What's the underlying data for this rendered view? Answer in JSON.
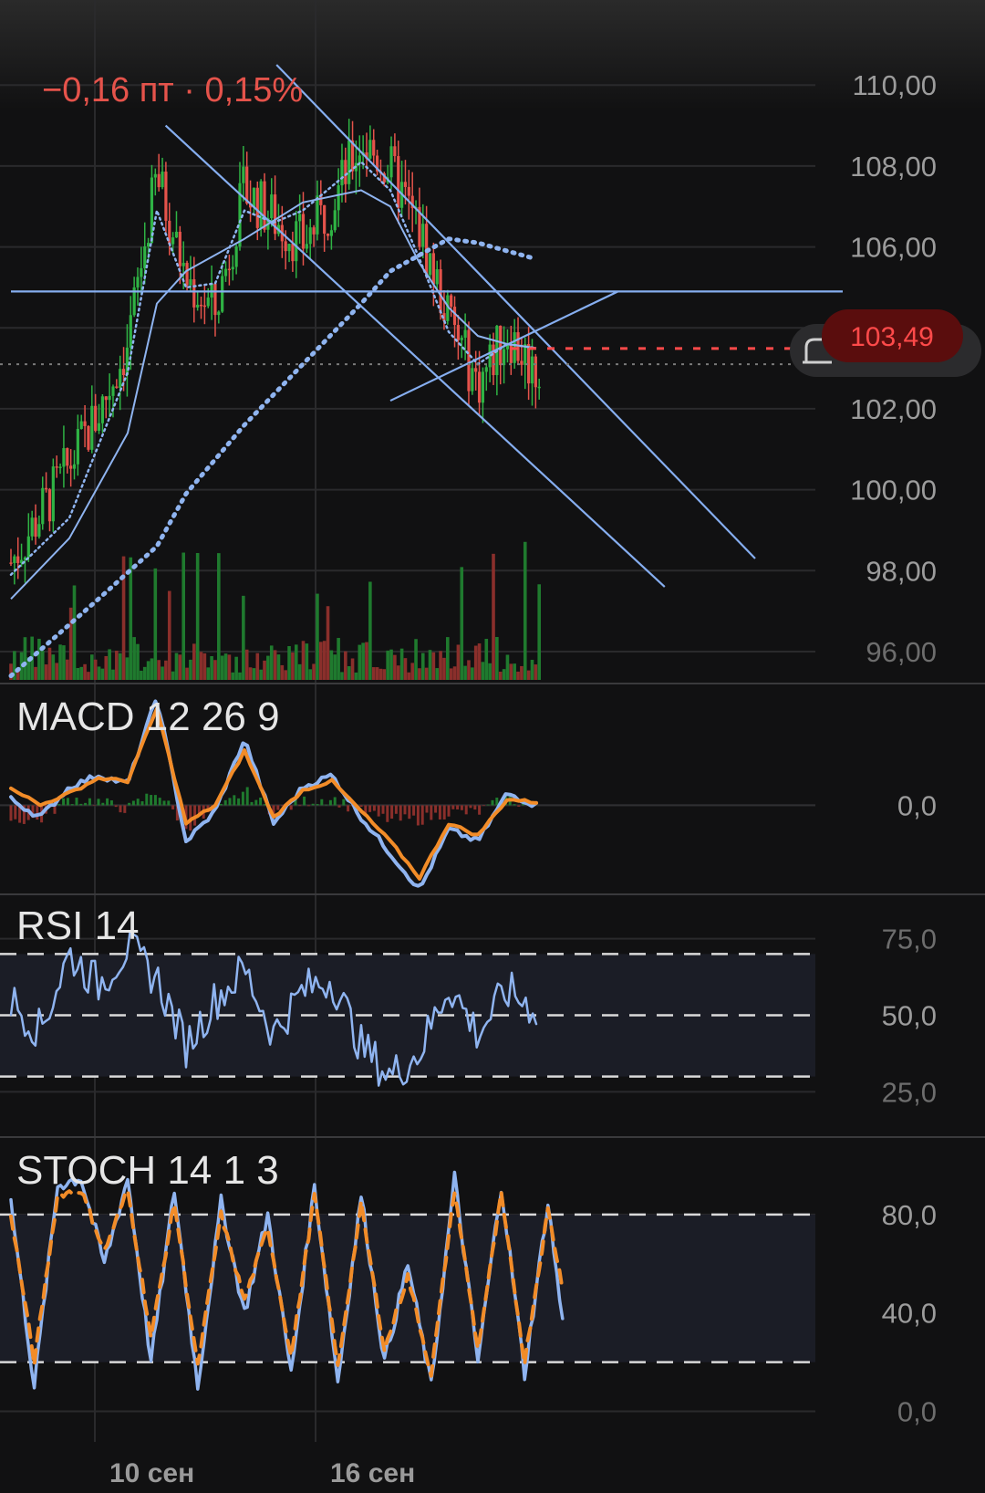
{
  "header": {
    "change_text": "−0,16 пт · 0,15%"
  },
  "colors": {
    "background": "#111112",
    "grid": "#2a2a2c",
    "up": "#2fb344",
    "down": "#e5534b",
    "ma": "#8fb4f0",
    "trendline": "#86aef0",
    "signal": "#f28c28",
    "price_badge": "#5a0d0d",
    "price_text": "#ff4a4a"
  },
  "dates": [
    {
      "label": "10 сен",
      "x": 10
    },
    {
      "label": "16 сен",
      "x": 16
    }
  ],
  "chart_data": [
    {
      "type": "candlestick",
      "title": "",
      "x": [
        0,
        1,
        2,
        3,
        4,
        5,
        6,
        7,
        8,
        9,
        10,
        11,
        12,
        13,
        14,
        15,
        16,
        17,
        18,
        19,
        20,
        21,
        22,
        23,
        24,
        25
      ],
      "close": [
        98.2,
        99.4,
        100.6,
        101.9,
        103.6,
        107.8,
        105.2,
        104.4,
        107.4,
        106.7,
        106.1,
        107.1,
        108.6,
        107.9,
        106.4,
        104.2,
        102.6,
        103.9,
        102.9,
        103.6,
        103.49
      ],
      "ylim": [
        95.3,
        111.2
      ],
      "yticks": [
        "110,00",
        "108,00",
        "106,00",
        "104,00",
        "102,00",
        "100,00",
        "98,00",
        "96,00"
      ],
      "ytick_values": [
        110,
        108,
        106,
        104,
        102,
        100,
        98,
        96
      ],
      "last_price": "103,49",
      "last_price_value": 103.49,
      "dotted_level": 103.1,
      "moving_averages": [
        {
          "style": "dotted-thick",
          "points": [
            [
              0,
              95.4
            ],
            [
              3,
              97.3
            ],
            [
              5,
              98.6
            ],
            [
              6,
              99.9
            ],
            [
              8,
              101.6
            ],
            [
              10,
              103.1
            ],
            [
              12,
              104.6
            ],
            [
              13,
              105.4
            ],
            [
              14,
              105.8
            ],
            [
              15,
              106.2
            ],
            [
              16,
              106.1
            ],
            [
              17,
              105.9
            ],
            [
              18,
              105.7
            ]
          ]
        },
        {
          "style": "solid",
          "points": [
            [
              0,
              97.3
            ],
            [
              2,
              98.8
            ],
            [
              4,
              101.4
            ],
            [
              5,
              104.6
            ],
            [
              6,
              105.4
            ],
            [
              8,
              106.2
            ],
            [
              10,
              107.1
            ],
            [
              12,
              107.4
            ],
            [
              13,
              107.0
            ],
            [
              14,
              105.6
            ],
            [
              15,
              104.5
            ],
            [
              16,
              103.8
            ],
            [
              17,
              103.6
            ],
            [
              18,
              103.5
            ]
          ]
        },
        {
          "style": "dotted-thin",
          "points": [
            [
              0,
              97.9
            ],
            [
              2,
              99.3
            ],
            [
              4,
              102.9
            ],
            [
              5,
              106.9
            ],
            [
              6,
              105.0
            ],
            [
              7,
              105.1
            ],
            [
              8,
              106.9
            ],
            [
              9,
              106.6
            ],
            [
              10,
              106.9
            ],
            [
              11,
              107.5
            ],
            [
              12,
              108.1
            ],
            [
              13,
              107.4
            ],
            [
              14,
              105.7
            ],
            [
              15,
              103.9
            ],
            [
              16,
              103.1
            ],
            [
              17,
              103.6
            ],
            [
              18,
              103.5
            ]
          ]
        }
      ],
      "trendlines": [
        {
          "from": [
            5.3,
            109.0
          ],
          "to": [
            22.4,
            97.6
          ]
        },
        {
          "from": [
            9.1,
            110.5
          ],
          "to": [
            25.5,
            98.3
          ]
        },
        {
          "from": [
            13.0,
            102.2
          ],
          "to": [
            20.8,
            104.9
          ]
        },
        {
          "from": [
            0.0,
            104.9
          ],
          "to": [
            28.5,
            104.9
          ]
        }
      ],
      "volume_note": "bars"
    },
    {
      "type": "line",
      "title": "MACD 12 26 9",
      "ylim": [
        -1.4,
        1.7
      ],
      "yticks": [
        "0,0"
      ],
      "ytick_values": [
        0
      ],
      "series": [
        {
          "role": "macd",
          "points": [
            [
              0,
              0.1
            ],
            [
              1,
              -0.2
            ],
            [
              2,
              0.3
            ],
            [
              3,
              0.5
            ],
            [
              4,
              0.35
            ],
            [
              5,
              1.8
            ],
            [
              6,
              -0.6
            ],
            [
              7,
              -0.1
            ],
            [
              8,
              1.1
            ],
            [
              9,
              -0.3
            ],
            [
              10,
              0.3
            ],
            [
              11,
              0.5
            ],
            [
              12,
              -0.2
            ],
            [
              13,
              -0.8
            ],
            [
              14,
              -1.4
            ],
            [
              15,
              -0.4
            ],
            [
              16,
              -0.6
            ],
            [
              17,
              0.2
            ],
            [
              18,
              0.0
            ]
          ]
        },
        {
          "role": "signal",
          "points": [
            [
              0,
              0.3
            ],
            [
              1,
              0.0
            ],
            [
              2,
              0.2
            ],
            [
              3,
              0.45
            ],
            [
              4,
              0.4
            ],
            [
              5,
              1.6
            ],
            [
              6,
              -0.3
            ],
            [
              7,
              0.0
            ],
            [
              8,
              0.9
            ],
            [
              9,
              -0.2
            ],
            [
              10,
              0.25
            ],
            [
              11,
              0.4
            ],
            [
              12,
              -0.1
            ],
            [
              13,
              -0.6
            ],
            [
              14,
              -1.2
            ],
            [
              15,
              -0.3
            ],
            [
              16,
              -0.5
            ],
            [
              17,
              0.1
            ],
            [
              18,
              0.05
            ]
          ]
        }
      ]
    },
    {
      "type": "line",
      "title": "RSI 14",
      "ylim": [
        15,
        85
      ],
      "yticks": [
        "75,0",
        "50,0",
        "25,0"
      ],
      "ytick_values": [
        75,
        50,
        25
      ],
      "bands": [
        70,
        50,
        30
      ],
      "series": [
        {
          "role": "rsi",
          "points": [
            [
              0,
              55
            ],
            [
              1,
              45
            ],
            [
              2,
              70
            ],
            [
              3,
              60
            ],
            [
              4,
              72
            ],
            [
              5,
              62
            ],
            [
              6,
              40
            ],
            [
              7,
              55
            ],
            [
              8,
              65
            ],
            [
              9,
              44
            ],
            [
              10,
              58
            ],
            [
              11,
              62
            ],
            [
              12,
              40
            ],
            [
              13,
              30
            ],
            [
              14,
              38
            ],
            [
              15,
              60
            ],
            [
              16,
              44
            ],
            [
              17,
              58
            ],
            [
              18,
              52
            ]
          ]
        }
      ]
    },
    {
      "type": "line",
      "title": "STOCH 14 1 3",
      "ylim": [
        -5,
        110
      ],
      "yticks": [
        "80,0",
        "40,0",
        "0,0"
      ],
      "ytick_values": [
        80,
        40,
        0
      ],
      "bands": [
        80,
        20
      ],
      "series": [
        {
          "role": "k",
          "points": [
            [
              0,
              85
            ],
            [
              0.8,
              10
            ],
            [
              1.6,
              92
            ],
            [
              2.4,
              95
            ],
            [
              3.2,
              60
            ],
            [
              4,
              95
            ],
            [
              4.8,
              20
            ],
            [
              5.6,
              90
            ],
            [
              6.4,
              10
            ],
            [
              7.2,
              85
            ],
            [
              8,
              40
            ],
            [
              8.8,
              80
            ],
            [
              9.6,
              15
            ],
            [
              10.4,
              92
            ],
            [
              11.2,
              12
            ],
            [
              12,
              88
            ],
            [
              12.8,
              20
            ],
            [
              13.6,
              60
            ],
            [
              14.4,
              10
            ],
            [
              15.2,
              95
            ],
            [
              16,
              20
            ],
            [
              16.8,
              92
            ],
            [
              17.6,
              15
            ],
            [
              18.4,
              85
            ],
            [
              18.9,
              36
            ]
          ]
        },
        {
          "role": "d",
          "points": [
            [
              0,
              80
            ],
            [
              0.8,
              20
            ],
            [
              1.6,
              88
            ],
            [
              2.4,
              90
            ],
            [
              3.2,
              65
            ],
            [
              4,
              90
            ],
            [
              4.8,
              30
            ],
            [
              5.6,
              85
            ],
            [
              6.4,
              18
            ],
            [
              7.2,
              80
            ],
            [
              8,
              45
            ],
            [
              8.8,
              75
            ],
            [
              9.6,
              22
            ],
            [
              10.4,
              88
            ],
            [
              11.2,
              18
            ],
            [
              12,
              84
            ],
            [
              12.8,
              25
            ],
            [
              13.6,
              55
            ],
            [
              14.4,
              15
            ],
            [
              15.2,
              90
            ],
            [
              16,
              25
            ],
            [
              16.8,
              88
            ],
            [
              17.6,
              20
            ],
            [
              18.4,
              82
            ],
            [
              18.9,
              50
            ]
          ]
        }
      ]
    }
  ]
}
